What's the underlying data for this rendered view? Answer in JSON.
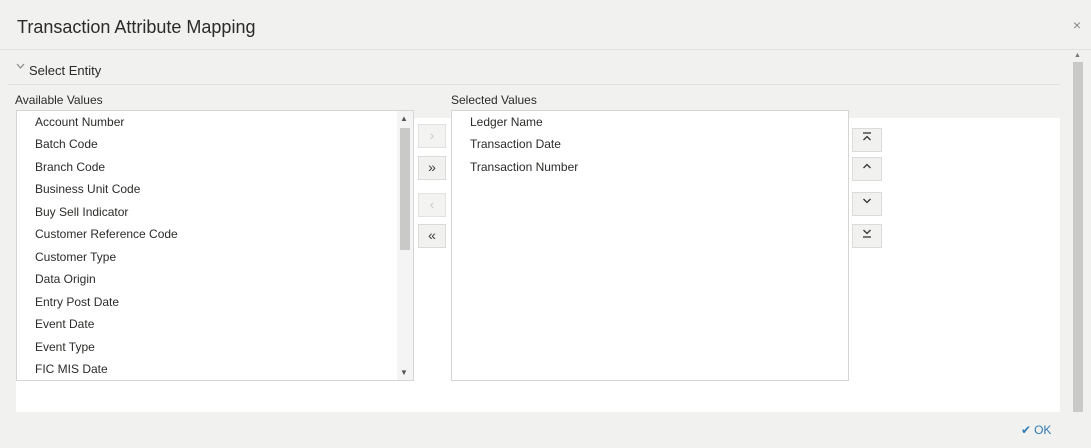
{
  "dialog": {
    "title": "Transaction Attribute Mapping",
    "close_glyph": "×"
  },
  "section": {
    "label": "Select Entity",
    "chevron_icon": "chevron-down-icon"
  },
  "available": {
    "label": "Available Values",
    "items": [
      "Account Number",
      "Batch Code",
      "Branch Code",
      "Business Unit Code",
      "Buy Sell Indicator",
      "Customer Reference Code",
      "Customer Type",
      "Data Origin",
      "Entry Post Date",
      "Event Date",
      "Event Type",
      "FIC MIS Date"
    ]
  },
  "selected": {
    "label": "Selected Values",
    "items": [
      "Ledger Name",
      "Transaction Date",
      "Transaction Number"
    ]
  },
  "shuttle": {
    "move": "›",
    "move_all": "»",
    "remove": "‹",
    "remove_all": "«"
  },
  "order": {
    "top": "⤒",
    "up": "⌃",
    "down": "⌄",
    "bottom": "⤓"
  },
  "footer": {
    "ok_label": "OK",
    "ok_icon_glyph": "✔"
  },
  "colors": {
    "accent": "#2f7ab6",
    "background": "#f1f1f0"
  }
}
